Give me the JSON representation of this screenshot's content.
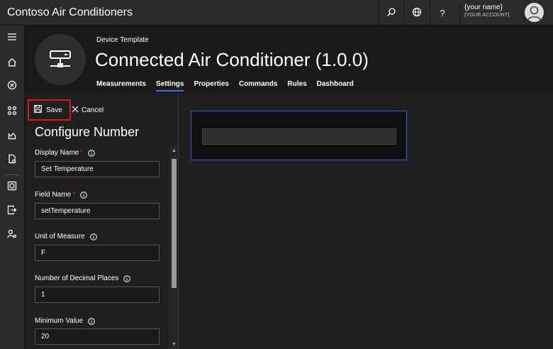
{
  "app": {
    "title": "Contoso Air Conditioners"
  },
  "topbar": {
    "user_name": "{your name}",
    "user_account": "{YOUR ACCOUNT}",
    "help_label": "?"
  },
  "header": {
    "breadcrumb": "Device Template",
    "title": "Connected Air Conditioner  (1.0.0)",
    "tabs": [
      {
        "label": "Measurements"
      },
      {
        "label": "Settings",
        "active": true
      },
      {
        "label": "Properties"
      },
      {
        "label": "Commands"
      },
      {
        "label": "Rules"
      },
      {
        "label": "Dashboard"
      }
    ]
  },
  "panel": {
    "save_label": "Save",
    "cancel_label": "Cancel",
    "title": "Configure Number",
    "required_marker": "*",
    "fields": [
      {
        "label": "Display Name",
        "required": true,
        "value": "Set Temperature"
      },
      {
        "label": "Field Name",
        "required": true,
        "value": "setTemperature"
      },
      {
        "label": "Unit of Measure",
        "required": false,
        "value": "F"
      },
      {
        "label": "Number of Decimal Places",
        "required": false,
        "value": "1"
      },
      {
        "label": "Minimum Value",
        "required": false,
        "value": "20"
      }
    ]
  },
  "colors": {
    "accent": "#2b7cd3",
    "highlight_border": "#e0112b",
    "preview_border": "#1b6ee0"
  },
  "icons": {
    "topbar": [
      "search-icon",
      "globe-icon",
      "help-icon",
      "avatar-icon"
    ],
    "leftnav": [
      "hamburger-menu-icon",
      "home-icon",
      "device-icon",
      "device-groups-icon",
      "analytics-icon",
      "jobs-icon",
      "device-templates-icon",
      "data-export-icon",
      "administration-icon"
    ]
  }
}
